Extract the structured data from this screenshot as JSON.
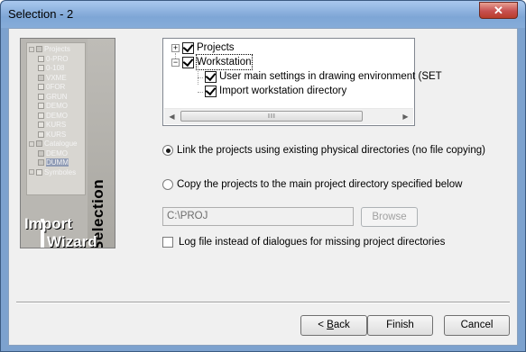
{
  "window": {
    "title": "Selection - 2",
    "close_glyph": "✕"
  },
  "side_image": {
    "tree_rows": [
      {
        "label": "Projects",
        "depth": 0,
        "has_pm": true,
        "checked": true
      },
      {
        "label": "0-PRO",
        "depth": 1,
        "has_pm": false,
        "checked": false
      },
      {
        "label": "0-108",
        "depth": 1,
        "has_pm": false,
        "checked": false
      },
      {
        "label": "VXME",
        "depth": 1,
        "has_pm": false,
        "checked": true
      },
      {
        "label": "0FOR",
        "depth": 1,
        "has_pm": false,
        "checked": false
      },
      {
        "label": "GRUN",
        "depth": 1,
        "has_pm": false,
        "checked": false
      },
      {
        "label": "DEMO",
        "depth": 1,
        "has_pm": false,
        "checked": false
      },
      {
        "label": "DEMO",
        "depth": 1,
        "has_pm": false,
        "checked": false
      },
      {
        "label": "KURS",
        "depth": 1,
        "has_pm": false,
        "checked": false
      },
      {
        "label": "KURS",
        "depth": 1,
        "has_pm": false,
        "checked": false
      },
      {
        "label": "Catalogue",
        "depth": 0,
        "has_pm": true,
        "checked": true
      },
      {
        "label": "DEMO",
        "depth": 1,
        "has_pm": false,
        "checked": true
      },
      {
        "label": "DUMM",
        "depth": 1,
        "has_pm": false,
        "checked": true
      },
      {
        "label": "Symboles",
        "depth": 0,
        "has_pm": true,
        "checked": false
      }
    ],
    "selection_text": "Selection",
    "import_text": "Import",
    "wizard_text": "Wizard"
  },
  "tree": {
    "items": [
      {
        "label": "Projects",
        "pm": "+",
        "checked": true
      },
      {
        "label": "Workstation",
        "pm": "−",
        "checked": true
      },
      {
        "label": "User main settings in drawing environment (SET",
        "checked": true
      },
      {
        "label": "Import workstation directory",
        "checked": true
      }
    ],
    "scroll_grip": "III",
    "left_arrow": "◀",
    "right_arrow": "▶"
  },
  "options": {
    "link_projects": {
      "label": "Link the projects using existing physical directories (no file copying)",
      "selected": true
    },
    "copy_projects": {
      "label": "Copy the projects to the main project directory specified below",
      "selected": false
    },
    "path_value": "C:\\PROJ",
    "browse_label": "Browse",
    "log_file": {
      "label": "Log file instead of dialogues for missing project directories",
      "checked": false
    }
  },
  "footer": {
    "back_accel": "B",
    "back_rest": "ack",
    "back_prefix": "< ",
    "finish_label": "Finish",
    "cancel_label": "Cancel"
  }
}
